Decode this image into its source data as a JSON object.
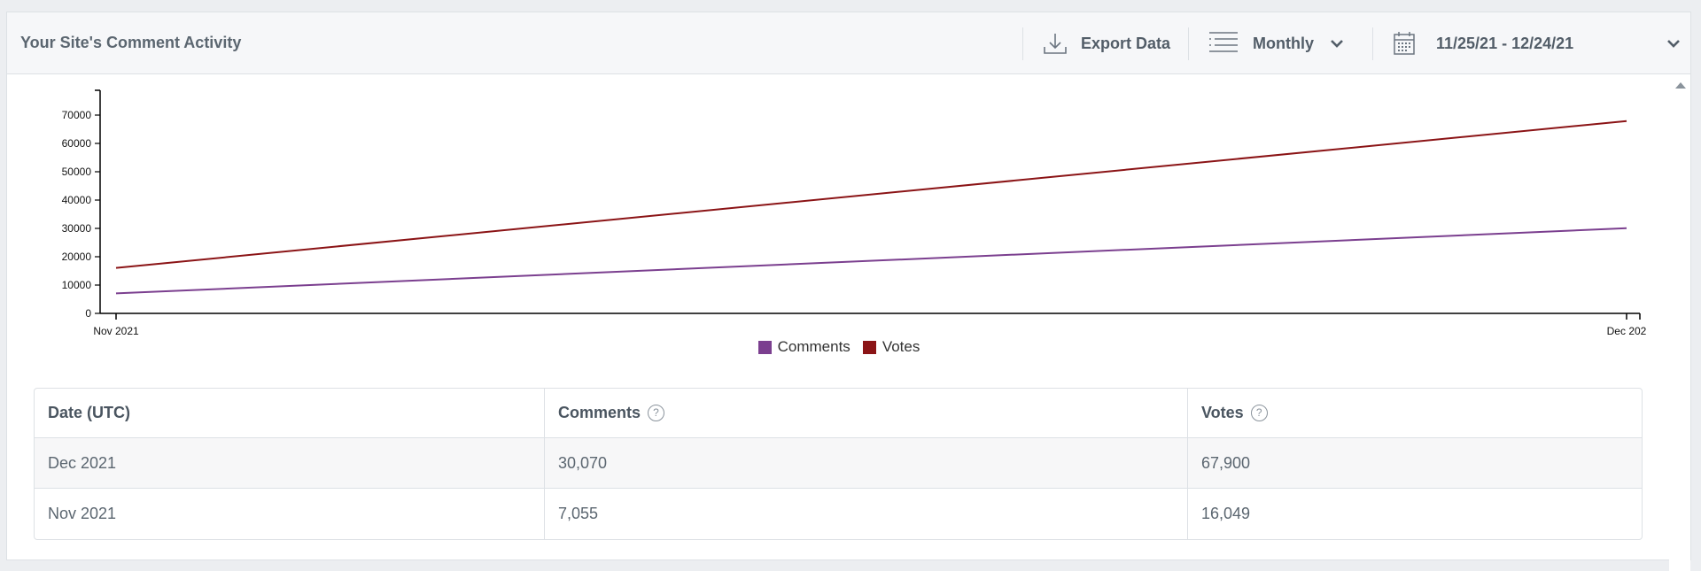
{
  "header": {
    "title": "Your Site's Comment Activity",
    "export_label": "Export Data",
    "interval_label": "Monthly",
    "date_range": "11/25/21 - 12/24/21"
  },
  "icons": {
    "export": "download-icon",
    "interval": "list-icon",
    "calendar": "calendar-icon",
    "chevron": "chevron-down-icon",
    "help": "question-circle-icon"
  },
  "colors": {
    "comments": "#7b3f8f",
    "votes": "#8b1416"
  },
  "chart_data": {
    "type": "line",
    "x": [
      "Nov 2021",
      "Dec 2021"
    ],
    "x_tick_labels": [
      "Nov 2021",
      "Dec 202"
    ],
    "series": [
      {
        "name": "Comments",
        "values": [
          7055,
          30070
        ],
        "color": "#7b3f8f"
      },
      {
        "name": "Votes",
        "values": [
          16049,
          67900
        ],
        "color": "#8b1416"
      }
    ],
    "y_ticks": [
      0,
      10000,
      20000,
      30000,
      40000,
      50000,
      60000,
      70000
    ],
    "ylim": [
      0,
      75000
    ],
    "grid": false,
    "legend": "bottom-center"
  },
  "table": {
    "headers": [
      "Date (UTC)",
      "Comments",
      "Votes"
    ],
    "help_glyph": "?",
    "rows": [
      [
        "Dec 2021",
        "30,070",
        "67,900"
      ],
      [
        "Nov 2021",
        "7,055",
        "16,049"
      ]
    ]
  }
}
